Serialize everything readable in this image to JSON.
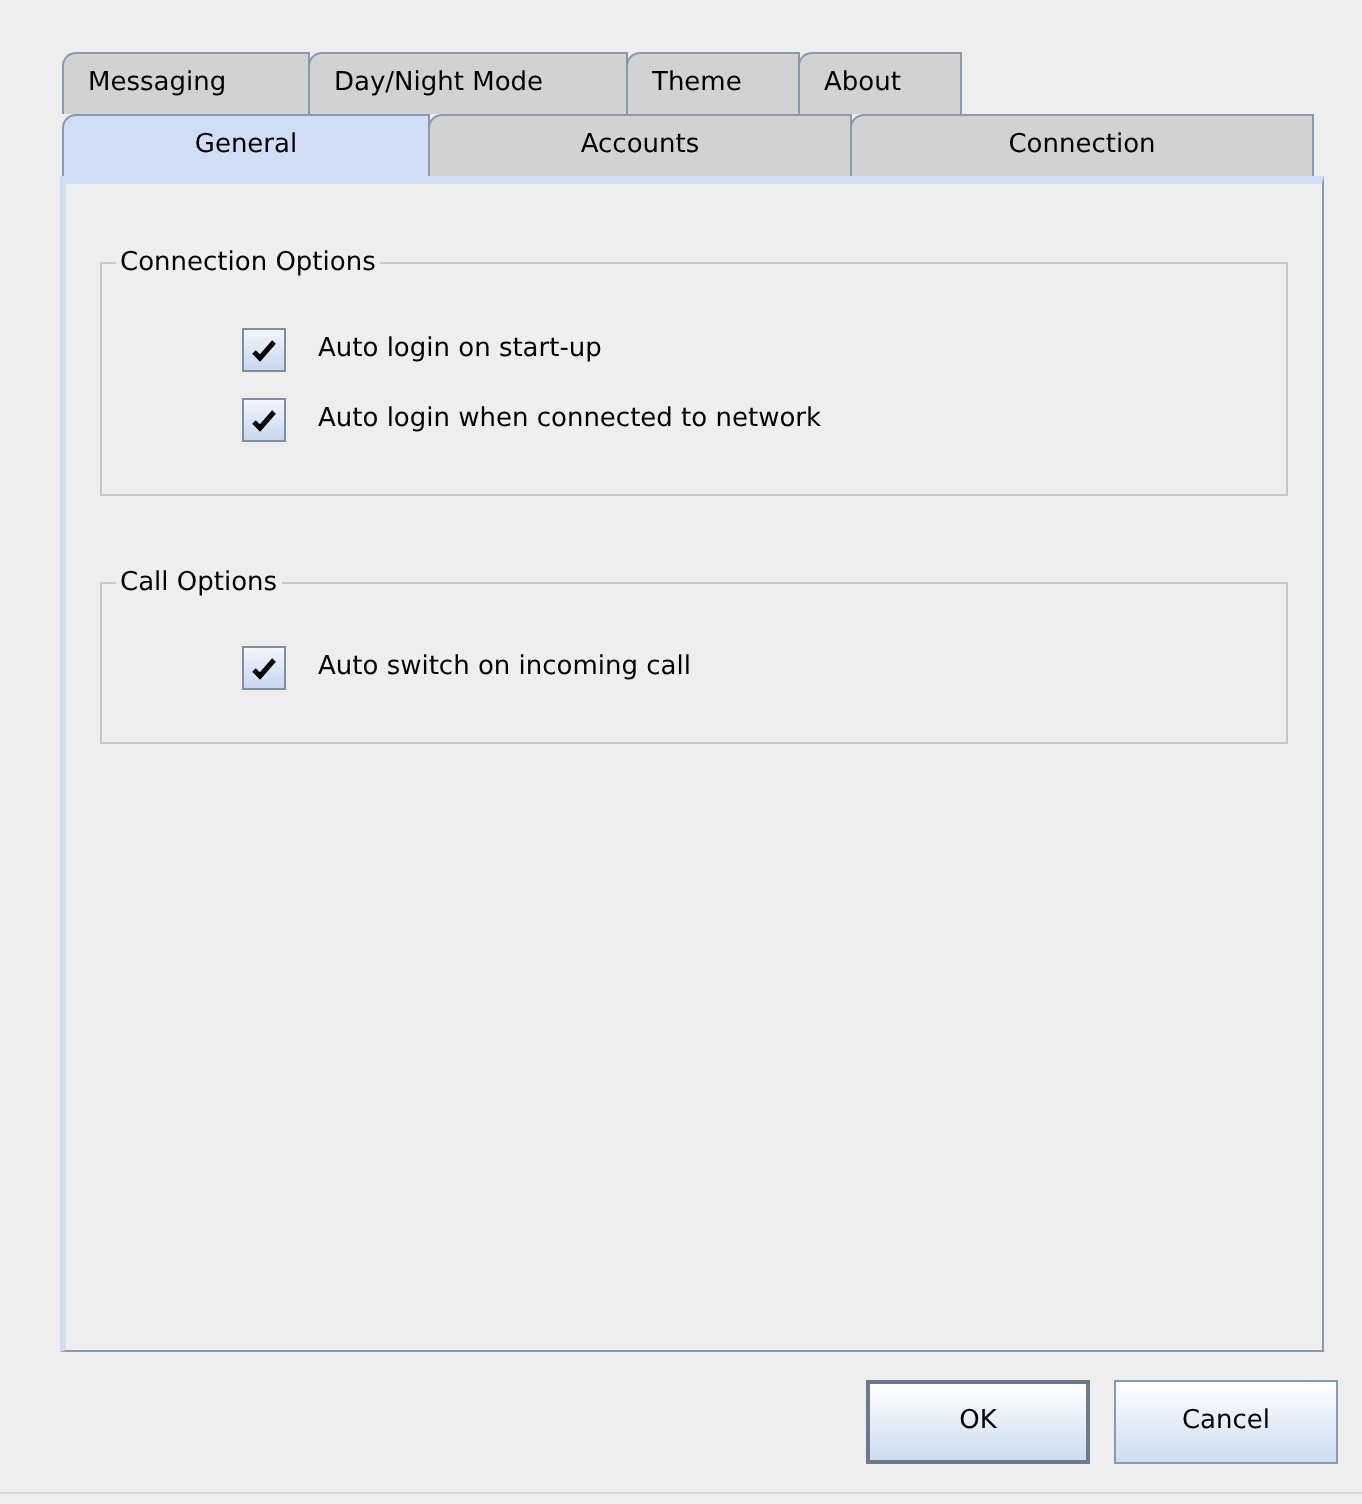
{
  "tab_rows": [
    [
      {
        "label": "Messaging",
        "selected": false
      },
      {
        "label": "Day/Night Mode",
        "selected": false
      },
      {
        "label": "Theme",
        "selected": false
      },
      {
        "label": "About",
        "selected": false
      }
    ],
    [
      {
        "label": "General",
        "selected": true
      },
      {
        "label": "Accounts",
        "selected": false
      },
      {
        "label": "Connection",
        "selected": false
      }
    ]
  ],
  "groups": [
    {
      "title": "Connection Options",
      "options": [
        {
          "label": "Auto login on start-up",
          "checked": true
        },
        {
          "label": "Auto login when connected to network",
          "checked": true
        }
      ]
    },
    {
      "title": "Call Options",
      "options": [
        {
          "label": "Auto switch on incoming call",
          "checked": true
        }
      ]
    }
  ],
  "buttons": [
    {
      "label": "OK",
      "default": true
    },
    {
      "label": "Cancel",
      "default": false
    }
  ]
}
